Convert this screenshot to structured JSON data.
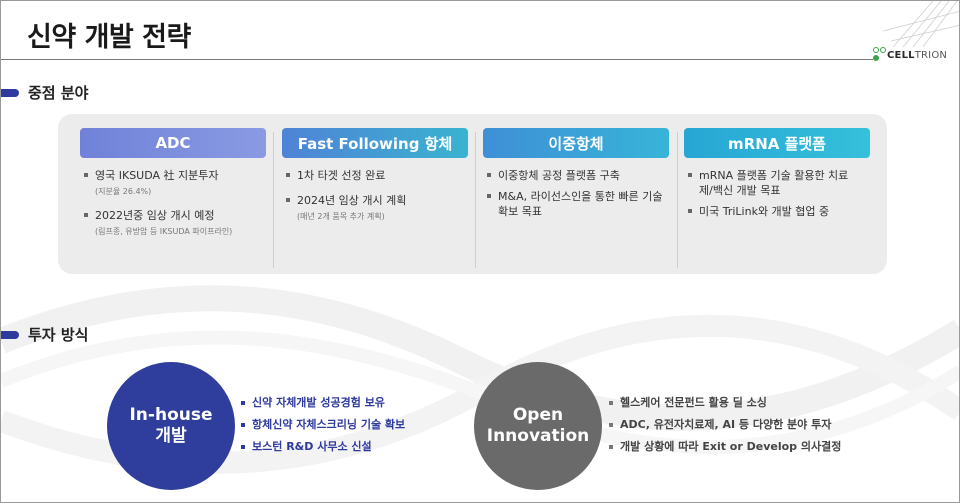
{
  "title": "신약 개발 전략",
  "logo": {
    "bold": "CELL",
    "rest": "TRION"
  },
  "sections": {
    "focus": "중점 분야",
    "invest": "투자 방식"
  },
  "columns": [
    {
      "header": "ADC",
      "items": [
        {
          "text": "영국 IKSUDA 社 지분투자",
          "sub": "(지분율 26.4%)"
        },
        {
          "text": "2022년중 임상 개시 예정",
          "sub": "(림프종, 유방암 등 IKSUDA 파이프라인)"
        }
      ]
    },
    {
      "header": "Fast Following 항체",
      "items": [
        {
          "text": "1차 타겟 선정 완료",
          "sub": ""
        },
        {
          "text": "2024년 임상 개시 계획",
          "sub": "(매년 2개 품목 추가 계획)"
        }
      ]
    },
    {
      "header": "이중항체",
      "items": [
        {
          "text": "이중항체 공정 플랫폼 구축",
          "sub": ""
        },
        {
          "text": "M&A, 라이선스인을 통한 빠른 기술 확보 목표",
          "sub": ""
        }
      ]
    },
    {
      "header": "mRNA 플랫폼",
      "items": [
        {
          "text": "mRNA 플랫폼 기술 활용한 치료제/백신 개발 목표",
          "sub": ""
        },
        {
          "text": "미국 TriLink와 개발 협업 중",
          "sub": ""
        }
      ]
    }
  ],
  "inhouse": {
    "line1": "In-house",
    "line2": "개발",
    "bullets": [
      "신약 자체개발 성공경험 보유",
      "항체신약 자체스크리닝 기술 확보",
      "보스턴 R&D 사무소 신설"
    ]
  },
  "open": {
    "line1": "Open",
    "line2": "Innovation",
    "bullets": [
      "헬스케어 전문펀드 활용 딜 소싱",
      "ADC, 유전자치료제, AI 등 다양한 분야 투자",
      "개발 상황에 따라 Exit or Develop 의사결정"
    ]
  },
  "colors": {
    "accent": "#2e3a9e",
    "open_circle": "#6a6a6a",
    "panel_bg": "#ececec"
  }
}
